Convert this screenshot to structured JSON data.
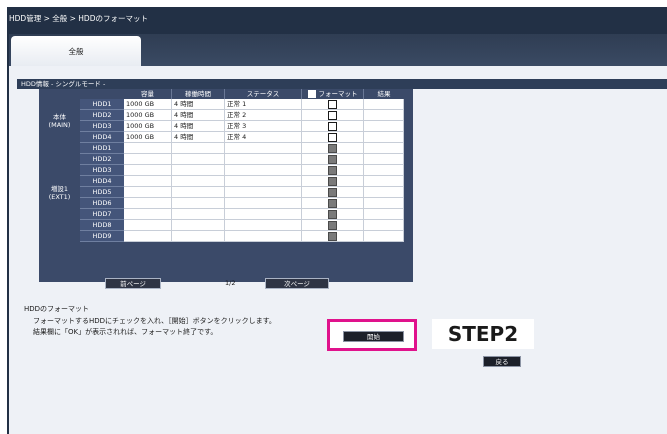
{
  "breadcrumb": "HDD管理 > 全般 > HDDのフォーマット",
  "tab_label": "全般",
  "section_title": "HDD情報 - シングルモード -",
  "columns": {
    "capacity": "容量",
    "runtime": "稼働時間",
    "status": "ステータス",
    "format": "フォーマット",
    "result": "結果"
  },
  "groups": [
    {
      "label_1": "本体",
      "label_2": "(MAIN)",
      "rows": [
        {
          "name": "HDD1",
          "capacity": "1000 GB",
          "runtime": "4 時間",
          "status": "正常 1",
          "format_enabled": true,
          "result": ""
        },
        {
          "name": "HDD2",
          "capacity": "1000 GB",
          "runtime": "4 時間",
          "status": "正常 2",
          "format_enabled": true,
          "result": ""
        },
        {
          "name": "HDD3",
          "capacity": "1000 GB",
          "runtime": "4 時間",
          "status": "正常 3",
          "format_enabled": true,
          "result": ""
        },
        {
          "name": "HDD4",
          "capacity": "1000 GB",
          "runtime": "4 時間",
          "status": "正常 4",
          "format_enabled": true,
          "result": ""
        }
      ]
    },
    {
      "label_1": "増設1",
      "label_2": "(EXT1)",
      "rows": [
        {
          "name": "HDD1",
          "capacity": "",
          "runtime": "",
          "status": "",
          "format_enabled": false,
          "result": ""
        },
        {
          "name": "HDD2",
          "capacity": "",
          "runtime": "",
          "status": "",
          "format_enabled": false,
          "result": ""
        },
        {
          "name": "HDD3",
          "capacity": "",
          "runtime": "",
          "status": "",
          "format_enabled": false,
          "result": ""
        },
        {
          "name": "HDD4",
          "capacity": "",
          "runtime": "",
          "status": "",
          "format_enabled": false,
          "result": ""
        },
        {
          "name": "HDD5",
          "capacity": "",
          "runtime": "",
          "status": "",
          "format_enabled": false,
          "result": ""
        },
        {
          "name": "HDD6",
          "capacity": "",
          "runtime": "",
          "status": "",
          "format_enabled": false,
          "result": ""
        },
        {
          "name": "HDD7",
          "capacity": "",
          "runtime": "",
          "status": "",
          "format_enabled": false,
          "result": ""
        },
        {
          "name": "HDD8",
          "capacity": "",
          "runtime": "",
          "status": "",
          "format_enabled": false,
          "result": ""
        },
        {
          "name": "HDD9",
          "capacity": "",
          "runtime": "",
          "status": "",
          "format_enabled": false,
          "result": ""
        }
      ]
    }
  ],
  "pagination": {
    "prev_label": "前ページ",
    "page_text": "1/2",
    "next_label": "次ページ"
  },
  "help": {
    "title": "HDDのフォーマット",
    "line1": "フォーマットするHDDにチェックを入れ、［開始］ボタンをクリックします。",
    "line2": "結果欄に「OK」が表示されれば、フォーマット終了です。"
  },
  "start_button_label": "開始",
  "step_label": "STEP2",
  "back_button_label": "戻る",
  "colors": {
    "frame": "#223045",
    "highlight": "#e0128c",
    "grid": "#3b4a69"
  }
}
